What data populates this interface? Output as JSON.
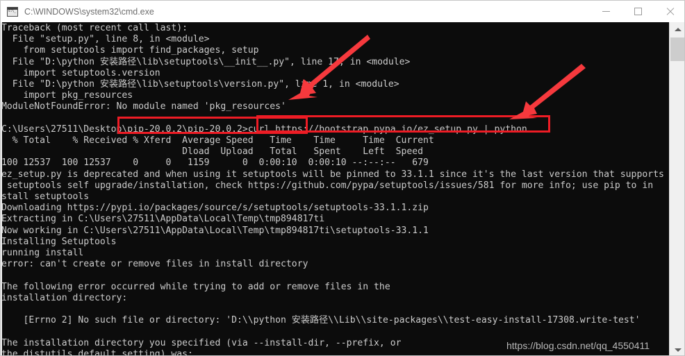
{
  "window": {
    "title": "C:\\WINDOWS\\system32\\cmd.exe",
    "icon": "cmd-icon",
    "controls": {
      "minimize": "Minimize",
      "maximize": "Maximize",
      "close": "Close"
    }
  },
  "terminal": {
    "background_color": "#0c0c0c",
    "text_color": "#cccccc",
    "content": "Traceback (most recent call last):\n  File \"setup.py\", line 8, in <module>\n    from setuptools import find_packages, setup\n  File \"D:\\python 安装路径\\lib\\setuptools\\__init__.py\", line 17, in <module>\n    import setuptools.version\n  File \"D:\\python 安装路径\\lib\\setuptools\\version.py\", line 1, in <module>\n    import pkg_resources\nModuleNotFoundError: No module named 'pkg_resources'\n\nC:\\Users\\27511\\Desktop\\pip-20.0.2\\pip-20.0.2>curl https://bootstrap.pypa.io/ez_setup.py | python\n  % Total    % Received % Xferd  Average Speed   Time    Time     Time  Current\n                                 Dload  Upload   Total   Spent    Left  Speed\n100 12537  100 12537    0     0   1159      0  0:00:10  0:00:10 --:--:--   679\nez_setup.py is deprecated and when using it setuptools will be pinned to 33.1.1 since it's the last version that supports\n setuptools self upgrade/installation, check https://github.com/pypa/setuptools/issues/581 for more info; use pip to in\nstall setuptools\nDownloading https://pypi.io/packages/source/s/setuptools/setuptools-33.1.1.zip\nExtracting in C:\\Users\\27511\\AppData\\Local\\Temp\\tmp894817ti\nNow working in C:\\Users\\27511\\AppData\\Local\\Temp\\tmp894817ti\\setuptools-33.1.1\nInstalling Setuptools\nrunning install\nerror: can't create or remove files in install directory\n\nThe following error occurred while trying to add or remove files in the\ninstallation directory:\n\n    [Errno 2] No such file or directory: 'D:\\\\python 安装路径\\\\Lib\\\\site-packages\\\\test-easy-install-17308.write-test'\n\nThe installation directory you specified (via --install-dir, --prefix, or\nthe distutils default setting) was:"
  },
  "annotations": {
    "accent_color": "#ee1c25",
    "box_error_message": "No module named 'pkg_resources'",
    "box_command": "curl https://bootstrap.pypa.io/ez_setup.py | python",
    "arrow_to_error": "arrow pointing to error message box",
    "arrow_to_command": "arrow pointing to curl command box"
  },
  "scrollbar": {
    "up_arrow": "scroll-up",
    "down_arrow": "scroll-down",
    "thumb": "scroll-thumb"
  },
  "watermark": {
    "text": "https://blog.csdn.net/qq_4550411"
  }
}
